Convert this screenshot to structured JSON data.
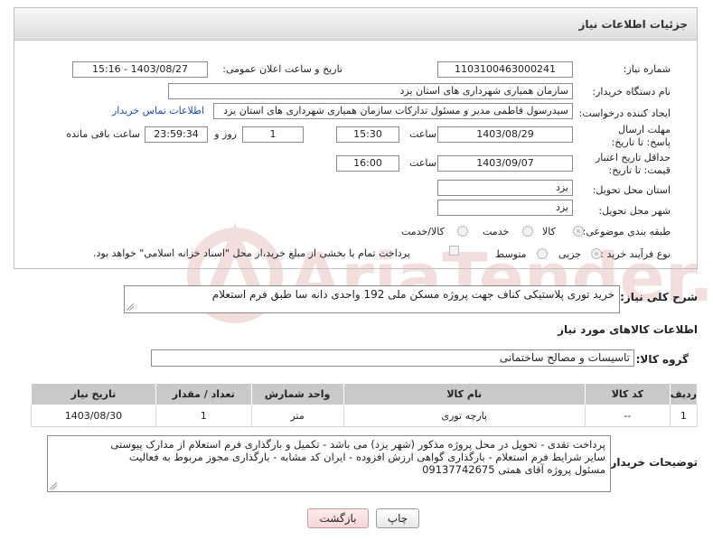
{
  "header": {
    "title": "جزئیات اطلاعات نیاز"
  },
  "fields": {
    "need_number_label": "شماره نیاز:",
    "need_number": "1103100463000241",
    "announce_label": "تاریخ و ساعت اعلان عمومی:",
    "announce_value": "1403/08/27 - 15:16",
    "buyer_label": "نام دستگاه خریدار:",
    "buyer_value": "سازمان همیاری شهرداری های استان یزد",
    "requester_label": "ایجاد کننده درخواست:",
    "requester_value": "سیدرسول فاطمی مدیر و مسئول تدارکات سازمان همیاری شهرداری های استان یزد",
    "contact_link": "اطلاعات تماس خریدار",
    "deadline_label": "مهلت ارسال پاسخ: تا تاریخ:",
    "deadline_date": "1403/08/29",
    "time_label": "ساعت",
    "deadline_time": "15:30",
    "days_value": "1",
    "days_label": "روز و",
    "remaining_value": "23:59:34",
    "remaining_label": "ساعت باقی مانده",
    "validity_label": "حداقل تاریخ اعتبار قیمت: تا تاریخ:",
    "validity_date": "1403/09/07",
    "validity_time_label": "ساعت",
    "validity_time": "16:00",
    "province_label": "استان محل تحویل:",
    "province_value": "یزد",
    "city_label": "شهر محل تحویل:",
    "city_value": "یزد",
    "category_label": "طبقه بندی موضوعی:",
    "category_options": [
      "کالا",
      "خدمت",
      "کالا/خدمت"
    ],
    "purchase_label": "نوع فرآیند خرید :",
    "purchase_options": [
      "جزیی",
      "متوسط"
    ],
    "treasury_note": "پرداخت تمام یا بخشی از مبلغ خرید،از محل \"اسناد خزانه اسلامی\" خواهد بود."
  },
  "description": {
    "label": "شرح کلی نیاز:",
    "value": "خرید توری پلاستیکی کناف جهت پروژه مسکن ملی 192 واحدی دانه سا طبق فرم استعلام"
  },
  "goods_section": {
    "title": "اطلاعات کالاهای مورد نیاز",
    "group_label": "گروه کالا:",
    "group_value": "تاسیسات و مصالح ساختمانی"
  },
  "table": {
    "headers": [
      "ردیف",
      "کد کالا",
      "نام کالا",
      "واحد شمارش",
      "تعداد / مقدار",
      "تاریخ نیاز"
    ],
    "rows": [
      [
        "1",
        "--",
        "پارچه توری",
        "متر",
        "1",
        "1403/08/30"
      ]
    ]
  },
  "buyer_notes": {
    "label": "توضیحات خریدار:",
    "lines": [
      "پرداخت نقدی - تحویل در محل پروژه مذکور (شهر یزد) می باشد - تکمیل و بارگذاری فرم استعلام از مدارک پیوستی",
      "سایر شرایط فرم استعلام - بارگذاری گواهی ارزش افزوده - ایران کد مشابه - بارگذاری مجوز مربوط به فعالیت",
      "مسئول پروژه آقای همتی 09137742675"
    ]
  },
  "buttons": {
    "print": "چاپ",
    "back": "بازگشت"
  },
  "colors": {
    "link": "#1a4bc0",
    "header_bg": "#dcdcdc",
    "table_header": "#c9c9c9",
    "watermark": "#e8b7b7"
  }
}
